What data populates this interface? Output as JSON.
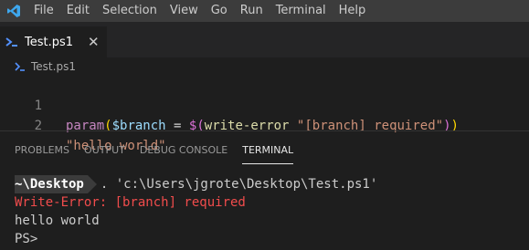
{
  "menubar": {
    "icon": "vscode-logo-icon",
    "items": [
      "File",
      "Edit",
      "Selection",
      "View",
      "Go",
      "Run",
      "Terminal",
      "Help"
    ]
  },
  "tabs": [
    {
      "label": "Test.ps1",
      "icon": "powershell-icon",
      "active": true
    }
  ],
  "breadcrumb": {
    "label": "Test.ps1",
    "icon": "powershell-icon"
  },
  "editor": {
    "lines": [
      {
        "number": "1",
        "tokens": {
          "kw": "param",
          "open_paren": "(",
          "var": "$branch",
          "assign": " = ",
          "sub_open": "$(",
          "fn": "write-error",
          "space": " ",
          "str": "\"[branch] required\"",
          "sub_close": ")",
          "close_paren": ")"
        }
      },
      {
        "number": "2",
        "tokens": {
          "str": "\"hello world\""
        }
      }
    ]
  },
  "panel": {
    "tabs": [
      "PROBLEMS",
      "OUTPUT",
      "DEBUG CONSOLE",
      "TERMINAL"
    ],
    "active_tab": "TERMINAL"
  },
  "terminal": {
    "prompt_path": "~\\Desktop",
    "command": ". 'c:\\Users\\jgrote\\Desktop\\Test.ps1'",
    "error_line": "Write-Error: [branch] required",
    "output_line": "hello world",
    "final_prompt": "PS>"
  },
  "colors": {
    "background": "#1e1e1e",
    "menubar": "#3c3c3c",
    "keyword": "#c586c0",
    "variable": "#9cdcfe",
    "function": "#dcdcaa",
    "string": "#ce9178",
    "error": "#f14c4c"
  }
}
